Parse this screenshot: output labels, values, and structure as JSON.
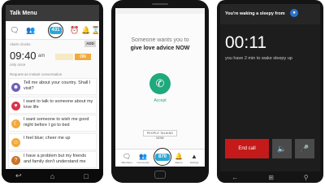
{
  "phone1": {
    "title": "Talk Menu",
    "badge": "431",
    "alarm_label": "Alarm clocks",
    "add_label": "ADD",
    "alarm_time": "09:40",
    "alarm_ampm": "am",
    "alarm_repeat": "only once",
    "snooze_label": "",
    "toggle_label": "ON",
    "request_label": "Request an instant conversation",
    "requests": [
      {
        "text": "Tell me about your country. Shall I visit?",
        "icon": "person-icon",
        "color": "#6b63b5"
      },
      {
        "text": "I want to talk to someone about my love life",
        "icon": "heart-icon",
        "color": "#d8344b"
      },
      {
        "text": "I want someone to wish me good night before I go to bed",
        "icon": "moon-icon",
        "color": "#f2a93b"
      },
      {
        "text": "I feel blue; cheer me up",
        "icon": "smile-icon",
        "color": "#f2a93b"
      },
      {
        "text": "I have a problem but my friends and family don't understand me",
        "icon": "help-icon",
        "color": "#c8742d"
      }
    ]
  },
  "phone2": {
    "line1": "Someone wants you to",
    "line2": "give love advice NOW",
    "accept": "Accept",
    "people_talking": "PEOPLE TALKING NOW",
    "badge": "870",
    "tabs": [
      "Talk Menu",
      "Community",
      "",
      "Alarms",
      "Settings"
    ]
  },
  "phone3": {
    "header": "You're waking a sleepy from",
    "timer": "00:11",
    "message": "you have 2 min to wake sleepy up",
    "end_call": "End call"
  }
}
